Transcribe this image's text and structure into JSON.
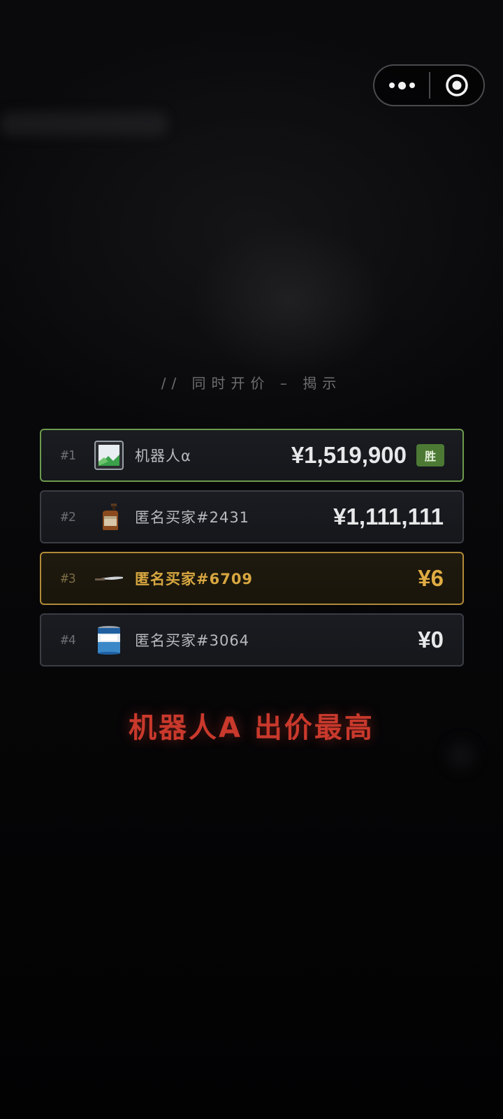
{
  "capsule": {
    "more_icon": "more-dots-icon",
    "close_icon": "target-circle-icon"
  },
  "reveal": {
    "title": "//  同时开价 – 揭示"
  },
  "bids": [
    {
      "rank": "#1",
      "avatar_icon": "image-placeholder-icon",
      "bidder": "机器人α",
      "amount": "¥1,519,900",
      "badge": "胜",
      "status": "winner"
    },
    {
      "rank": "#2",
      "avatar_icon": "bottle-icon",
      "bidder": "匿名买家#2431",
      "amount": "¥1,111,111",
      "status": "normal"
    },
    {
      "rank": "#3",
      "avatar_icon": "knife-icon",
      "bidder": "匿名买家#6709",
      "amount": "¥6",
      "status": "self"
    },
    {
      "rank": "#4",
      "avatar_icon": "paint-can-icon",
      "bidder": "匿名买家#3064",
      "amount": "¥0",
      "status": "normal"
    }
  ],
  "result": {
    "text": "机器人A 出价最高"
  },
  "colors": {
    "winner_border": "#6c9a4c",
    "self_border": "#b08a38",
    "self_text": "#d8a741",
    "result_red": "#c9392c",
    "badge_green": "#4c7a34"
  }
}
